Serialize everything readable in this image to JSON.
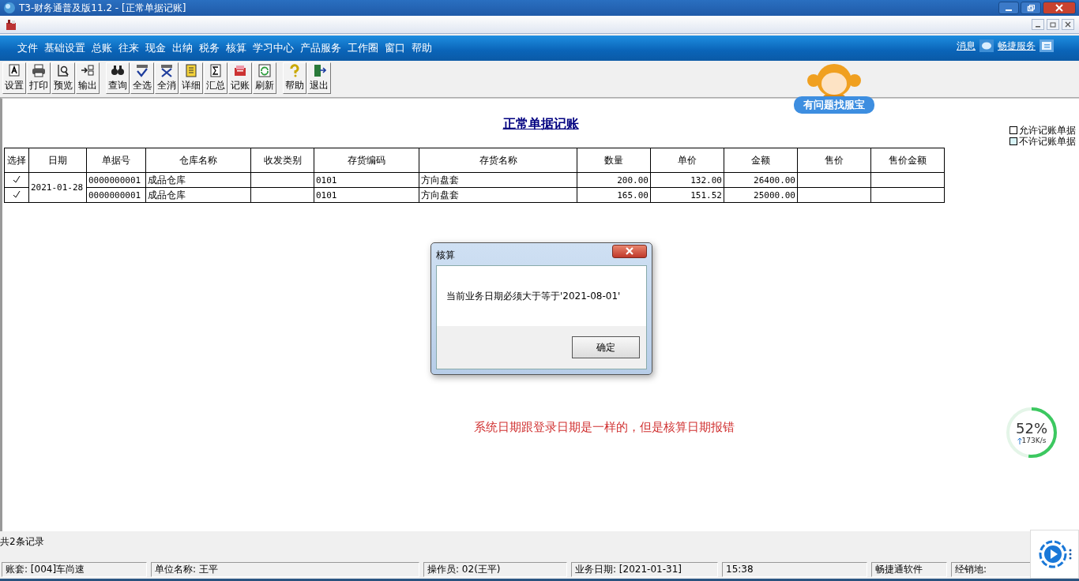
{
  "window": {
    "title": "T3-财务通普及版11.2 - [正常单据记账]"
  },
  "menu": [
    "文件",
    "基础设置",
    "总账",
    "往来",
    "现金",
    "出纳",
    "税务",
    "核算",
    "学习中心",
    "产品服务",
    "工作圈",
    "窗口",
    "帮助"
  ],
  "menu_links": [
    {
      "label": "消息",
      "kind": "chat"
    },
    {
      "label": "畅捷服务",
      "kind": "panel"
    }
  ],
  "toolbar": [
    [
      {
        "label": "设置",
        "kind": "settings"
      },
      {
        "label": "打印",
        "kind": "print"
      },
      {
        "label": "预览",
        "kind": "preview"
      },
      {
        "label": "输出",
        "kind": "export"
      }
    ],
    [
      {
        "label": "查询",
        "kind": "query"
      },
      {
        "label": "全选",
        "kind": "select-all"
      },
      {
        "label": "全消",
        "kind": "deselect-all"
      },
      {
        "label": "详细",
        "kind": "detail"
      },
      {
        "label": "汇总",
        "kind": "sum"
      },
      {
        "label": "记账",
        "kind": "post"
      },
      {
        "label": "刷新",
        "kind": "refresh"
      }
    ],
    [
      {
        "label": "帮助",
        "kind": "help"
      },
      {
        "label": "退出",
        "kind": "exit"
      }
    ]
  ],
  "service_button": {
    "label": "有问题找服宝"
  },
  "page_title": "正常单据记账",
  "legend": [
    {
      "label": "允许记账单据",
      "color": "#ffffff"
    },
    {
      "label": "不许记账单据",
      "color": "#d8f4f8"
    }
  ],
  "table": {
    "columns": [
      "选择",
      "日期",
      "单据号",
      "仓库名称",
      "收发类别",
      "存货编码",
      "存货名称",
      "数量",
      "单价",
      "金额",
      "售价",
      "售价金额"
    ],
    "groups": [
      {
        "date": "2021-01-28",
        "rows": [
          {
            "checked": true,
            "number": "0000000001",
            "warehouse": "成品仓库",
            "code": "0101",
            "name": "方向盘套",
            "quantity": "200.00",
            "price": "132.00",
            "amount": "26400.00"
          },
          {
            "checked": true,
            "number": "0000000001",
            "warehouse": "成品仓库",
            "code": "0101",
            "name": "方向盘套",
            "quantity": "165.00",
            "price": "151.52",
            "amount": "25000.00"
          }
        ]
      }
    ]
  },
  "dialog": {
    "title": "核算",
    "message": "当前业务日期必须大于等于'2021-08-01'",
    "button": "确定"
  },
  "note": "系统日期跟登录日期是一样的，但是核算日期报错",
  "speed_widget": {
    "percent": "52%",
    "level": 0.52,
    "rate": "173K/s"
  },
  "record_count": "共2条记录",
  "status_bar": [
    "账套: [004]车尚速",
    "单位名称: 王平",
    "操作员: 02(王平)",
    "业务日期: [2021-01-31]",
    "15:38",
    "畅捷通软件",
    "经销地:"
  ]
}
